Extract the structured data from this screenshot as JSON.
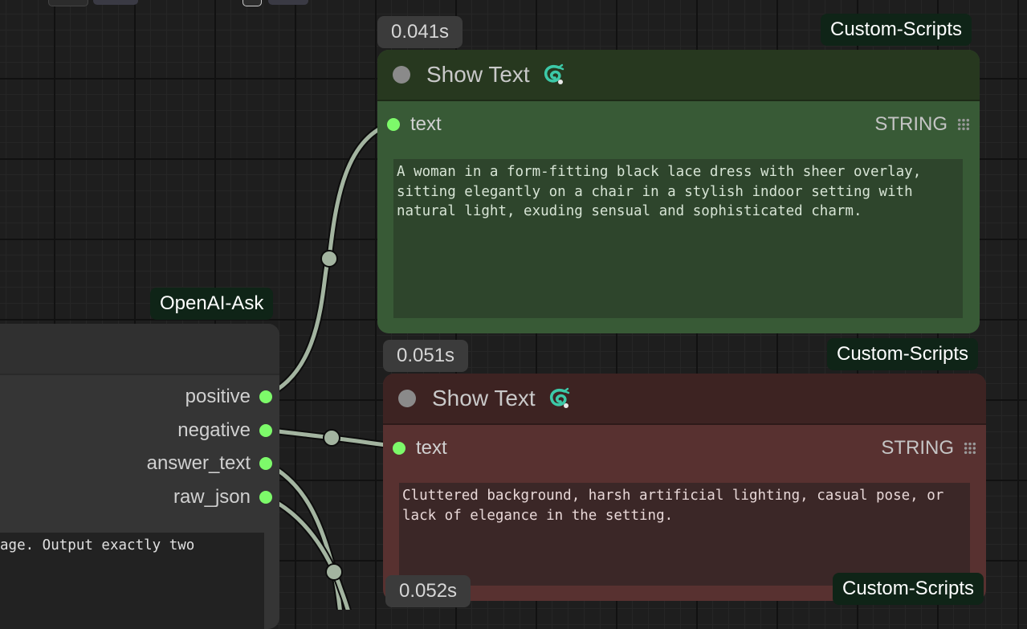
{
  "nodes": {
    "show_text_1": {
      "badge": "Custom-Scripts",
      "time": "0.041s",
      "title": "Show Text",
      "input_label": "text",
      "input_type": "STRING",
      "text": "A woman in a form-fitting black lace dress with sheer overlay, sitting elegantly on a chair in a stylish indoor setting with natural light, exuding sensual and sophisticated charm."
    },
    "show_text_2": {
      "badge": "Custom-Scripts",
      "time": "0.051s",
      "title": "Show Text",
      "input_label": "text",
      "input_type": "STRING",
      "text": "Cluttered background, harsh artificial lighting, casual pose, or lack of elegance in the setting."
    },
    "show_text_3": {
      "badge": "Custom-Scripts",
      "time": "0.052s"
    },
    "openai_ask": {
      "badge": "OpenAI-Ask",
      "outputs": [
        "positive",
        "negative",
        "answer_text",
        "raw_json"
      ],
      "prompt_fragment": "age. Output exactly two"
    }
  },
  "colors": {
    "green_node": "#385a36",
    "red_node": "#583130",
    "wire": "#a3b4a0",
    "socket": "#7dfa6a"
  },
  "icons": [
    "snake-python-icon",
    "grid-dots-icon"
  ]
}
